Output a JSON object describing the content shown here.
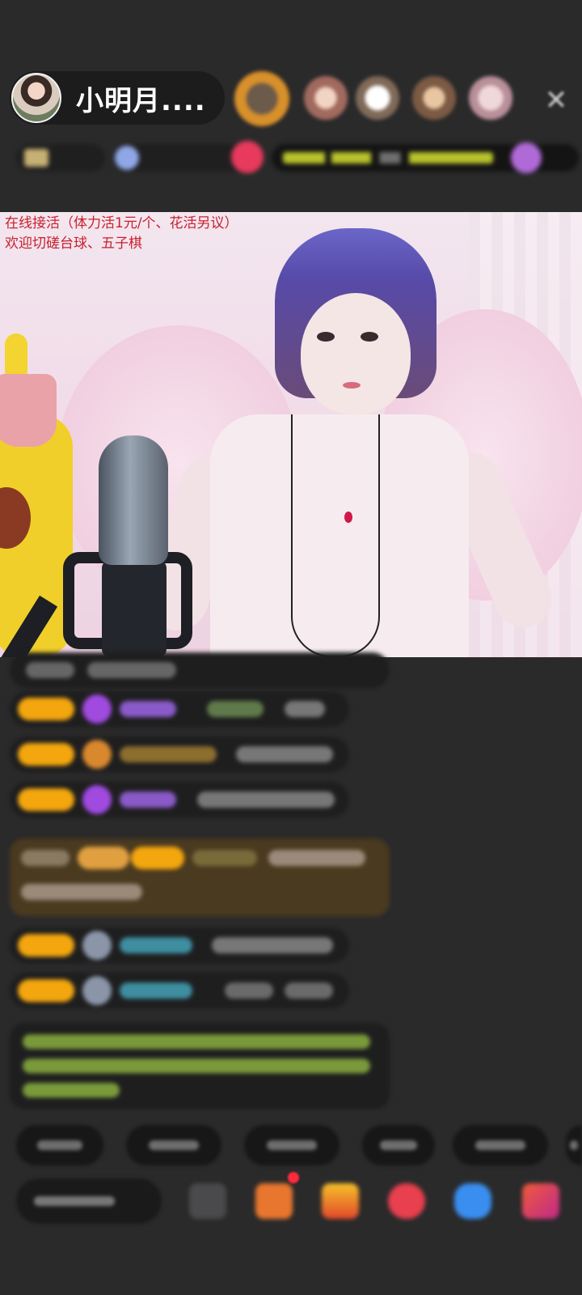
{
  "header": {
    "host_name": "小明月....",
    "close_icon": "close-icon"
  },
  "video": {
    "overlay_lines": [
      "在线接活（体力活1元/个、花活另议）",
      "欢迎切磋台球、五子棋"
    ]
  },
  "colors": {
    "background": "#2a2a2b",
    "overlay_text": "#c8202c",
    "badge": "#f3a60e"
  }
}
